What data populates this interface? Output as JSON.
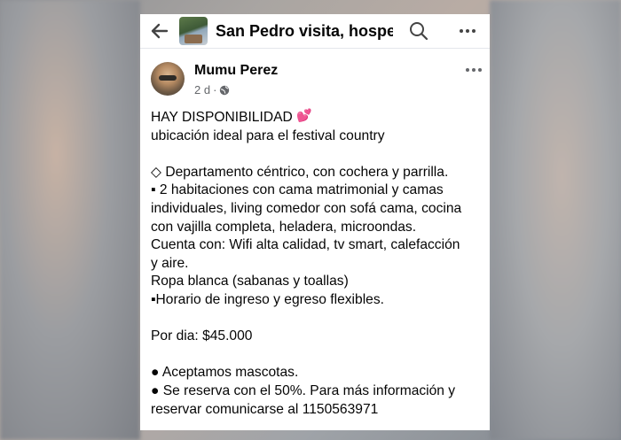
{
  "group": {
    "title": "San Pedro visita, hospe..."
  },
  "post": {
    "author": "Mumu Perez",
    "time": "2 d",
    "lines": [
      {
        "text": "HAY DISPONIBILIDAD",
        "emoji": "💕"
      },
      {
        "text": "ubicación ideal para el festival country"
      },
      {
        "text": ""
      },
      {
        "text": "◇ Departamento céntrico, con cochera y parrilla."
      },
      {
        "text": "▪ 2 habitaciones con cama matrimonial y camas"
      },
      {
        "text": "individuales, living comedor con sofá cama, cocina"
      },
      {
        "text": "con vajilla completa, heladera, microondas."
      },
      {
        "text": "Cuenta con: Wifi alta calidad, tv smart, calefacción"
      },
      {
        "text": "y aire."
      },
      {
        "text": "Ropa blanca (sabanas y toallas)"
      },
      {
        "text": "▪Horario de ingreso y egreso flexibles."
      },
      {
        "text": ""
      },
      {
        "text": "Por dia: $45.000"
      },
      {
        "text": ""
      },
      {
        "text": "● Aceptamos mascotas."
      },
      {
        "text": "● Se reserva con el 50%. Para más información y"
      },
      {
        "text": "reservar comunicarse al 1150563971"
      }
    ]
  },
  "icons": {
    "back": "arrow-left-icon",
    "search": "search-icon",
    "more": "more-horizontal-icon",
    "audience": "globe-icon"
  }
}
